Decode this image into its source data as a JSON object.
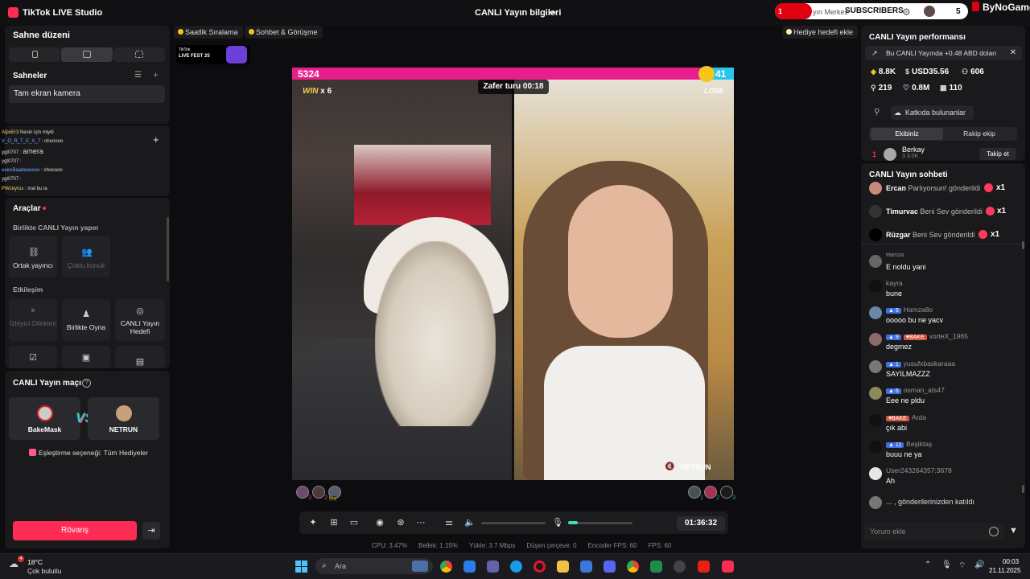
{
  "titlebar": {
    "app_name": "TikTok LIVE Studio",
    "center_title": "CANLI Yayın bilgileri",
    "overlay": {
      "count": "1",
      "label": "SUBSCRIBERS",
      "partial_text": "yın Merkez",
      "value": "5",
      "brand": "ByNoGame"
    }
  },
  "left": {
    "scene_layout_title": "Sahne düzeni",
    "scenes_title": "Sahneler",
    "scene_item": "Tam ekran kamera",
    "add_label": "+",
    "camera_label": "amera",
    "mini_chat": [
      {
        "name": "AlpoEr3",
        "text": "Nesin için miydi"
      },
      {
        "name": "V_O_R_T_E_X_7",
        "text": ": ohooooo"
      },
      {
        "name": "ygt0707",
        "text": ":"
      },
      {
        "name": "ygt0707",
        "text": ":"
      },
      {
        "name": "eeeeBaadeeeeee",
        "text": ": ohooooo"
      },
      {
        "name": "ygt0707",
        "text": ":"
      },
      {
        "name": "PWzeyrus",
        "text": ": mal bu la"
      }
    ],
    "tools_title": "Araçlar",
    "together_label": "Birlikte CANLI Yayın yapın",
    "tools_together": [
      {
        "label": "Ortak yayıncı",
        "icon": "link-icon",
        "enabled": true
      },
      {
        "label": "Çoklu konuk",
        "icon": "multi-guest-icon",
        "enabled": false
      }
    ],
    "interaction_label": "Etkileşim",
    "tools_interaction": [
      {
        "label": "İzleyici Dilekleri",
        "icon": "viewer-wishes-icon",
        "enabled": false
      },
      {
        "label": "Birlikte Oyna",
        "icon": "play-together-icon",
        "enabled": true
      },
      {
        "label": "CANLI Yayın Hedefi",
        "icon": "live-goal-icon",
        "enabled": true
      }
    ],
    "match_title": "CANLI Yayın maçı",
    "player_left": "BakeMask",
    "player_right": "NETRUN",
    "vs_label": "VS",
    "pairing_label": "Eşleştirme seçeneği: Tüm Hediyeler",
    "rematch_button": "Rövanş"
  },
  "center": {
    "chip_ranking": "Saatlik Sıralama",
    "chip_chat": "Sohbet & Görüşme",
    "chip_gift_goal": "Hediye hedefi ekle",
    "fest_badge_top": "TikTok",
    "fest_badge_bottom": "LIVE FEST 25",
    "battle": {
      "score_left": "5324",
      "score_right": "41",
      "score_left_fraction": 0.93,
      "timer": "Zafer turu 00:18",
      "win_label": "WIN",
      "win_multiplier": "x 6",
      "lose_label": "LOSE",
      "right_streamer": "NETRUN"
    },
    "supporters_left": [
      "3",
      "2",
      "Mvp"
    ],
    "supporters_right": [
      "1",
      "2",
      "3"
    ],
    "volume_level": 0.15,
    "elapsed": "01:36:32",
    "stats": {
      "cpu": "CPU:  3.47%",
      "memory": "Bellek:  1.15%",
      "upload": "Yükle:  3.7 Mbps",
      "dropped": "Düşen çerçeve:  0",
      "encoder_fps": "Encoder FPS:  60",
      "fps": "FPS:  60"
    }
  },
  "right": {
    "perf_title": "CANLI Yayın performansı",
    "promo_text": "Bu CANLI Yayında +0.48 ABD doları",
    "metrics": {
      "diamonds": "8.8K",
      "usd": "USD35.56",
      "viewers": "606",
      "new_followers": "219",
      "likes": "0.8M",
      "gifters": "110"
    },
    "contributors_button": "Katkıda bulunanlar",
    "tab_team": "Ekibiniz",
    "tab_rival": "Rakip ekip",
    "rank_position": "1",
    "rank_name": "Berkay",
    "rank_sub": "3   3.0K",
    "follow_button": "Takip et",
    "chat_title": "CANLI Yayın sohbeti",
    "gift_events": [
      {
        "name": "Ercan",
        "text": "Parlıyorsun! gönderildi",
        "count": "x1"
      },
      {
        "name": "Timurvac",
        "text": "Beni Sev gönderildi",
        "count": "x1"
      },
      {
        "name": "Rüzgar",
        "text": "Beni Sev gönderildi",
        "count": "x1"
      }
    ],
    "messages": [
      {
        "badge": "",
        "fan": "",
        "name": "Hamza",
        "text": "E noldu yani"
      },
      {
        "badge": "",
        "fan": "",
        "name": "kayra",
        "text": "bune"
      },
      {
        "badge": "5",
        "fan": "",
        "name": "Hamza8o",
        "text": "ooooo bu ne yacv"
      },
      {
        "badge": "9",
        "fan": "BAKE",
        "name": "vorteX_1965",
        "text": "degmez"
      },
      {
        "badge": "1",
        "fan": "",
        "name": "yusufxbaskaraaa",
        "text": "SAYILMAZZZ"
      },
      {
        "badge": "6",
        "fan": "",
        "name": "osman_ats47",
        "text": "Eee ne pldu"
      },
      {
        "badge": "",
        "fan": "BAKE",
        "name": "Arda",
        "text": "çık abi"
      },
      {
        "badge": "11",
        "fan": "",
        "name": "Beşiktaş",
        "text": "buuu ne ya"
      },
      {
        "badge": "",
        "fan": "",
        "name": "User243264357:3678",
        "text": "Ah"
      }
    ],
    "join_text": "... , gönderilerinizden katıldı",
    "comment_placeholder": "Yorum ekle"
  },
  "taskbar": {
    "temp": "18°C",
    "condition": "Çok bulutlu",
    "weather_badge": "4",
    "search_placeholder": "Ara",
    "time": "00:03",
    "date": "21.11.2025"
  }
}
